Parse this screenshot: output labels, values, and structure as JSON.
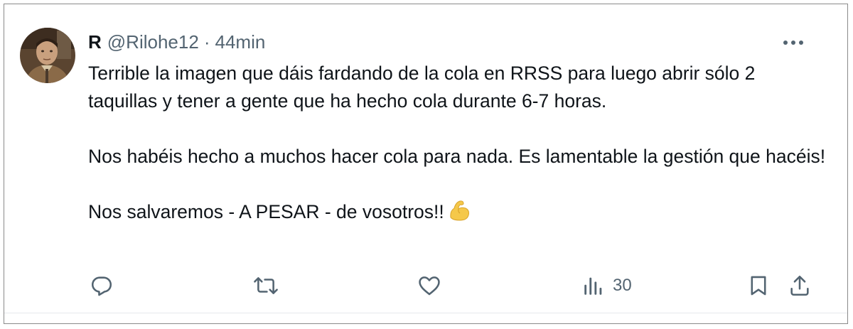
{
  "tweet": {
    "author_name": "R",
    "handle": "@Rilohe12",
    "separator": "·",
    "time": "44min",
    "paragraphs": [
      "Terrible la imagen que dáis fardando de la cola en RRSS para luego abrir sólo 2 taquillas y tener a gente que ha hecho cola durante 6-7 horas.",
      "Nos habéis hecho a muchos hacer cola para nada. Es lamentable la gestión que hacéis!",
      "Nos salvaremos - A PESAR - de vosotros!!"
    ],
    "emoji": "flexed-biceps-emoji",
    "avatar": "profile-photo"
  },
  "actions": {
    "reply_icon": "reply-icon",
    "retweet_icon": "retweet-icon",
    "like_icon": "heart-icon",
    "views_icon": "views-icon",
    "views_count": "30",
    "bookmark_icon": "bookmark-icon",
    "share_icon": "share-icon",
    "more_icon": "more-dots-icon"
  },
  "colors": {
    "text": "#0f1419",
    "secondary": "#536471",
    "emoji": "#f5c84a"
  }
}
